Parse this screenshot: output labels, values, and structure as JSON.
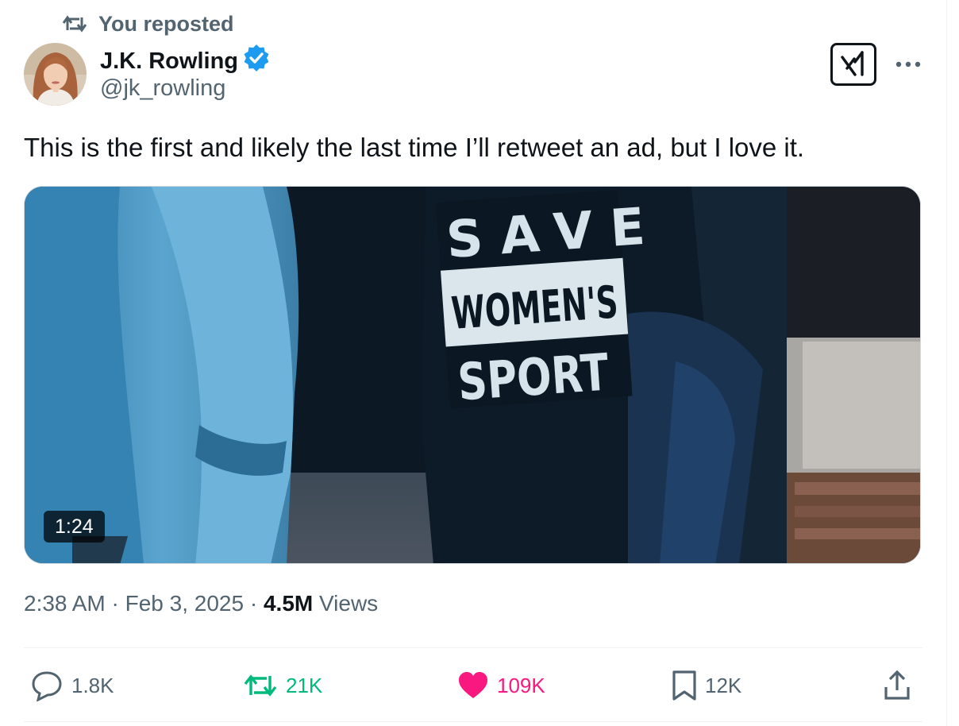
{
  "repost": {
    "text": "You reposted"
  },
  "author": {
    "name": "J.K. Rowling",
    "handle": "@jk_rowling"
  },
  "tweet": {
    "text": "This is the first and likely the last time I’ll retweet an ad, but I love it."
  },
  "media": {
    "duration": "1:24",
    "shirt_text": [
      "SAVE",
      "WOMEN'S",
      "SPORT"
    ]
  },
  "meta": {
    "time": "2:38 AM",
    "sep1": " · ",
    "date": "Feb 3, 2025",
    "sep2": " · ",
    "views_count": "4.5M",
    "views_label": " Views"
  },
  "actions": {
    "replies": "1.8K",
    "reposts": "21K",
    "likes": "109K",
    "bookmarks": "12K"
  },
  "colors": {
    "verified": "#1d9bf0",
    "repost_active": "#00ba7c",
    "like_active": "#f91880",
    "secondary_text": "#536471",
    "primary_text": "#0f1419"
  },
  "icons": {
    "repost_header": "repost-icon",
    "verified": "verified-badge-icon",
    "grok": "grok-icon",
    "more": "more-icon",
    "reply": "reply-icon",
    "repost": "repost-icon",
    "like": "heart-icon",
    "bookmark": "bookmark-icon",
    "share": "share-icon"
  }
}
